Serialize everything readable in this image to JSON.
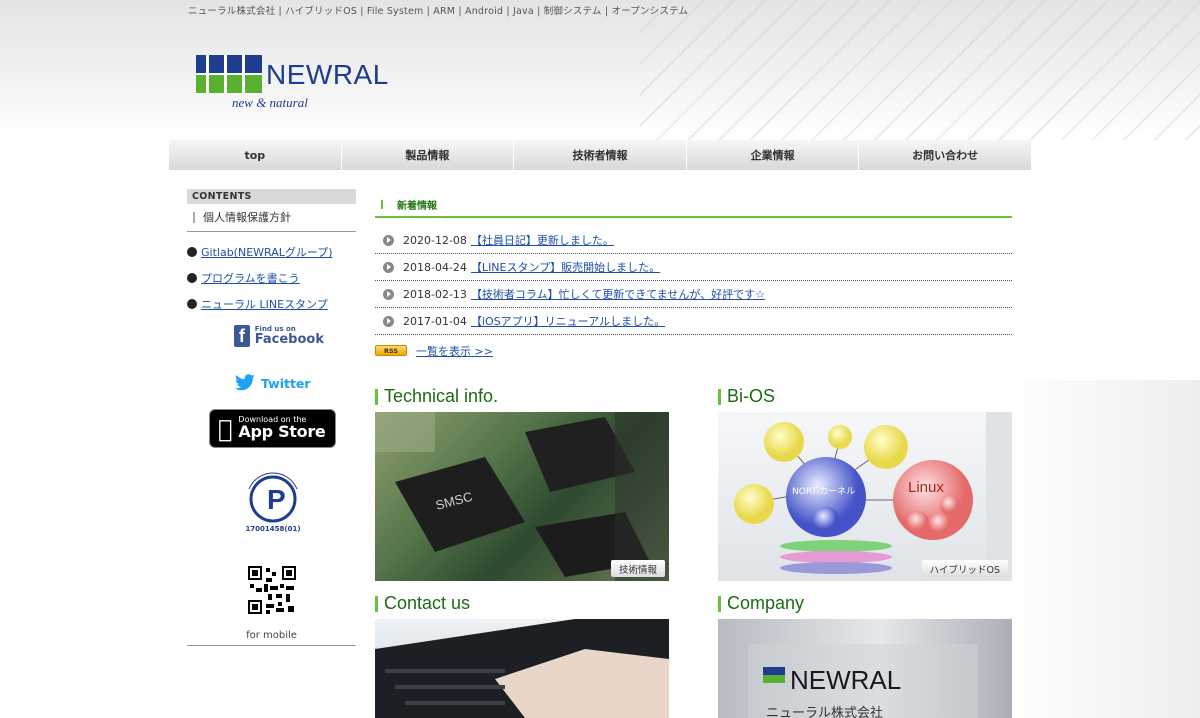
{
  "tagline": "ニューラル株式会社 | ハイブリッドOS | File System | ARM | Android | Java | 制御システム | オープンシステム",
  "logo": {
    "name": "NEWRAL",
    "sub": "new & natural"
  },
  "nav": [
    {
      "label": "top"
    },
    {
      "label": "製品情報"
    },
    {
      "label": "技術者情報"
    },
    {
      "label": "企業情報"
    },
    {
      "label": "お問い合わせ"
    }
  ],
  "sidebar": {
    "header": "CONTENTS",
    "policy": "個人情報保護方針",
    "links": [
      {
        "label": "Gitlab(NEWRALグループ)"
      },
      {
        "label": "プログラムを書こう"
      },
      {
        "label": "ニューラル LINEスタンプ"
      }
    ],
    "facebook": {
      "small": "Find us on",
      "big": "Facebook"
    },
    "twitter": "Twitter",
    "appstore": {
      "small": "Download on the",
      "big": "App Store"
    },
    "pmark": {
      "arc": "たいせつにしますプライバシー",
      "number": "17001458(01)"
    },
    "mobile": "for mobile"
  },
  "news": {
    "title": "新着情報",
    "items": [
      {
        "date": "2020-12-08",
        "text": "【社員日記】更新しました。"
      },
      {
        "date": "2018-04-24",
        "text": "【LINEスタンプ】販売開始しました。"
      },
      {
        "date": "2018-02-13",
        "text": "【技術者コラム】忙しくて更新できてませんが、好評です☆"
      },
      {
        "date": "2017-01-04",
        "text": "【iOSアプリ】リニューアルしました。"
      }
    ],
    "rss": "RSS",
    "more": "一覧を表示 >>"
  },
  "sections": {
    "tech": {
      "title": "Technical info.",
      "caption": "技術情報",
      "chip": "SMSC"
    },
    "bios": {
      "title": "Bi-OS",
      "caption": "ハイブリッドOS",
      "center": "NORTiカーネル",
      "right": "Linux"
    },
    "contact": {
      "title": "Contact us"
    },
    "company": {
      "title": "Company",
      "sign": "NEWRAL",
      "sign_sub": "ニューラル株式会社"
    }
  },
  "colors": {
    "brand": "#1f3d8f",
    "accent_green": "#6abf3c",
    "link": "#1d4fa8"
  }
}
